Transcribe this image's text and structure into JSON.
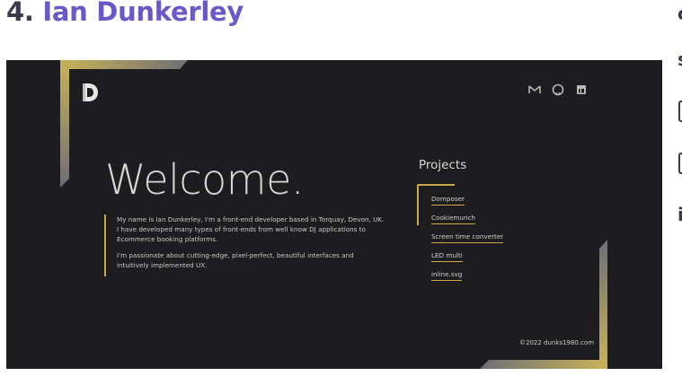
{
  "article": {
    "number": "4.",
    "name": "Ian Dunkerley"
  },
  "right_column": [
    "c",
    "s",
    "",
    "",
    "i"
  ],
  "site": {
    "logo": "D-monogram-logo",
    "social": [
      "mail-icon",
      "github-icon",
      "linkedin-icon"
    ],
    "welcome": "Welcome.",
    "intro": [
      "My name is Ian Dunkerley, I'm a front-end developer based in Torquay, Devon, UK. I have developed many types of front-ends from well know DJ applications to Ecommerce booking platforms.",
      "I'm passionate about cutting-edge, pixel-perfect, beautiful interfaces and intuitively implemented UX."
    ],
    "projects_title": "Projects",
    "projects": [
      "Domposer",
      "Cookiemunch",
      "Screen time converter",
      "LED multi",
      "inline.svg"
    ],
    "footer": "©2022 dunks1980.com",
    "colors": {
      "background": "#1d1c1e",
      "accent_gold": "#c9a94a",
      "heading_purple": "#6b57c8"
    }
  }
}
